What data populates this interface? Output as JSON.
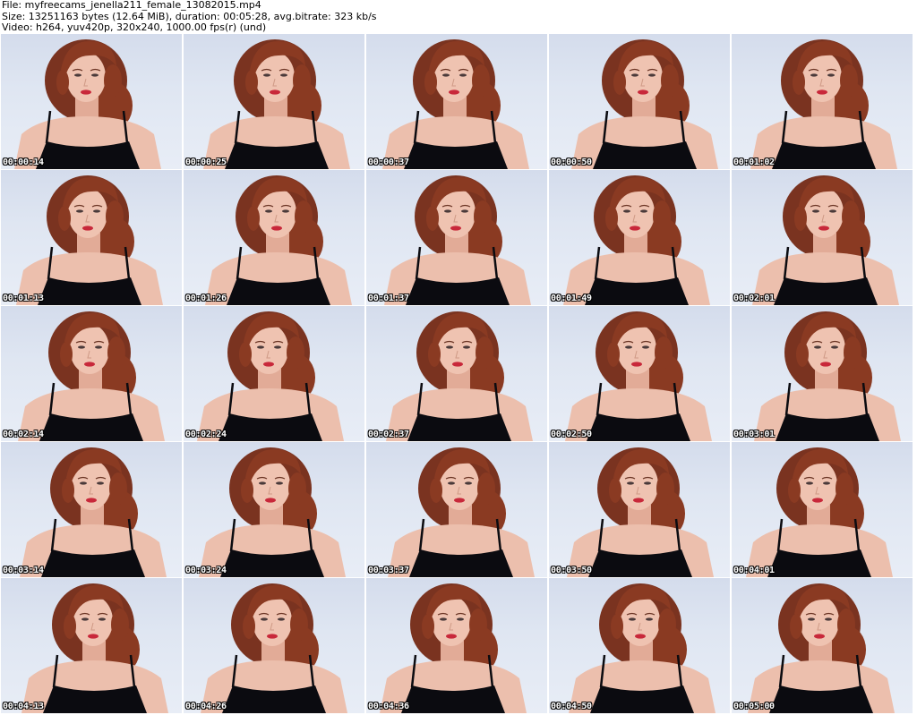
{
  "header": {
    "file_line": "File: myfreecams_jenella211_female_13082015.mp4",
    "size_line": "Size: 13251163 bytes (12.64 MiB), duration: 00:05:28, avg.bitrate: 323 kb/s",
    "video_line": "Video: h264, yuv420p, 320x240, 1000.00 fps(r) (und)"
  },
  "thumbnails": [
    {
      "timestamp": "00:00:14"
    },
    {
      "timestamp": "00:00:25"
    },
    {
      "timestamp": "00:00:37"
    },
    {
      "timestamp": "00:00:50"
    },
    {
      "timestamp": "00:01:02"
    },
    {
      "timestamp": "00:01:13"
    },
    {
      "timestamp": "00:01:26"
    },
    {
      "timestamp": "00:01:37"
    },
    {
      "timestamp": "00:01:49"
    },
    {
      "timestamp": "00:02:01"
    },
    {
      "timestamp": "00:02:14"
    },
    {
      "timestamp": "00:02:24"
    },
    {
      "timestamp": "00:02:37"
    },
    {
      "timestamp": "00:02:50"
    },
    {
      "timestamp": "00:03:01"
    },
    {
      "timestamp": "00:03:14"
    },
    {
      "timestamp": "00:03:24"
    },
    {
      "timestamp": "00:03:37"
    },
    {
      "timestamp": "00:03:50"
    },
    {
      "timestamp": "00:04:01"
    },
    {
      "timestamp": "00:04:13"
    },
    {
      "timestamp": "00:04:26"
    },
    {
      "timestamp": "00:04:36"
    },
    {
      "timestamp": "00:04:50"
    },
    {
      "timestamp": "00:05:00"
    }
  ],
  "colors": {
    "background": "#ffffff",
    "wall": "#dfe6f2",
    "hair": "#8a3a22",
    "skin": "#e9b9a6",
    "top": "#0b0b10",
    "lips": "#c8283a"
  }
}
